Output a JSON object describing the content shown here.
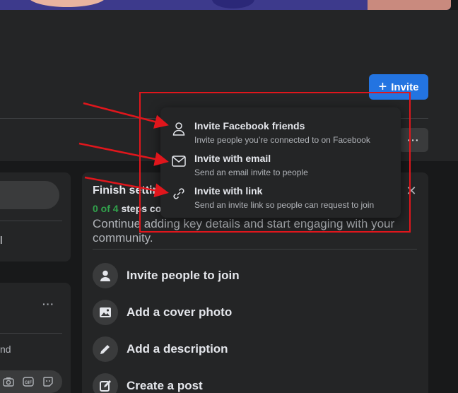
{
  "header": {
    "invite_button_label": "Invite",
    "more_label": "···"
  },
  "left_panel": {
    "card1_text": "l",
    "card2_more": "···",
    "composer_text": "nd"
  },
  "invite_menu": {
    "items": [
      {
        "title": "Invite Facebook friends",
        "subtitle": "Invite people you’re connected to on Facebook",
        "icon": "person-icon"
      },
      {
        "title": "Invite with email",
        "subtitle": "Send an email invite to people",
        "icon": "envelope-icon"
      },
      {
        "title": "Invite with link",
        "subtitle": "Send an invite link so people can request to join",
        "icon": "link-icon"
      }
    ]
  },
  "setup": {
    "title": "Finish setting up",
    "progress_count": "0 of 4",
    "progress_rest": " steps completed",
    "description": "Continue adding key details and start engaging with your community.",
    "close": "✕",
    "tasks": [
      {
        "label": "Invite people to join",
        "icon": "person-icon"
      },
      {
        "label": "Add a cover photo",
        "icon": "image-icon"
      },
      {
        "label": "Add a description",
        "icon": "pencil-icon"
      },
      {
        "label": "Create a post",
        "icon": "edit-icon"
      }
    ]
  },
  "colors": {
    "accent": "#2374e1",
    "progress_green": "#31a24c",
    "annotation_red": "#e0161c"
  }
}
